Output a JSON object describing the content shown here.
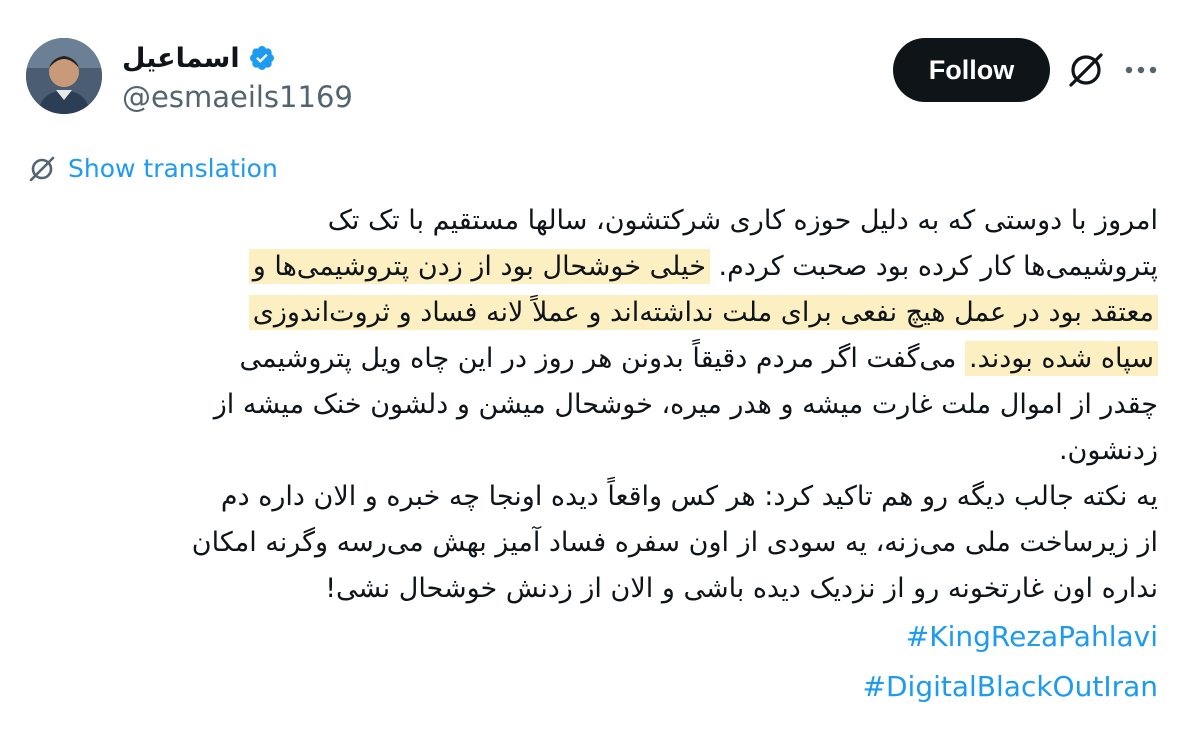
{
  "author": {
    "display_name": "اسماعیل",
    "handle": "@esmaeils1169",
    "verified": true
  },
  "actions": {
    "follow_label": "Follow",
    "icons": [
      "grok-icon",
      "more-icon"
    ]
  },
  "translation": {
    "label": "Show translation",
    "icon": "translate-icon"
  },
  "tweet": {
    "lines": [
      [
        {
          "t": "امروز با دوستی که به دلیل حوزه کاری شرکتشون، سالها مستقیم با تک تک",
          "hl": false
        }
      ],
      [
        {
          "t": "پتروشیمی‌ها کار کرده بود صحبت کردم. ",
          "hl": false
        },
        {
          "t": "خیلی خوشحال بود از زدن پتروشیمی‌ها و",
          "hl": true
        }
      ],
      [
        {
          "t": "معتقد بود در عمل هیچ نفعی برای ملت نداشته‌اند و عملاً لانه فساد و ثروت‌اندوزی",
          "hl": true
        }
      ],
      [
        {
          "t": "سپاه شده بودند.",
          "hl": true
        },
        {
          "t": " می‌گفت اگر مردم دقیقاً بدونن هر روز در این چاه ویل پتروشیمی",
          "hl": false
        }
      ],
      [
        {
          "t": "چقدر از اموال ملت غارت میشه و هدر میره، خوشحال میشن و دلشون خنک میشه از",
          "hl": false
        }
      ],
      [
        {
          "t": "زدنشون.",
          "hl": false
        }
      ],
      [
        {
          "t": "یه نکته جالب دیگه رو هم تاکید کرد: هر کس واقعاً دیده اونجا چه خبره و الان داره دم",
          "hl": false
        }
      ],
      [
        {
          "t": "از زیرساخت ملی می‌زنه، یه سودی از اون سفره فساد آمیز بهش می‌رسه وگرنه امکان",
          "hl": false
        }
      ],
      [
        {
          "t": "نداره اون غارتخونه رو از نزدیک دیده باشی و الان از زدنش خوشحال نشی!",
          "hl": false
        }
      ]
    ],
    "hashtags": [
      "#KingRezaPahlavi",
      "#DigitalBlackOutIran"
    ],
    "highlight_color": "#fcefc2"
  },
  "colors": {
    "accent": "#1d9bf0",
    "text": "#0f1419",
    "secondary": "#536471",
    "follow_bg": "#0f1419"
  }
}
